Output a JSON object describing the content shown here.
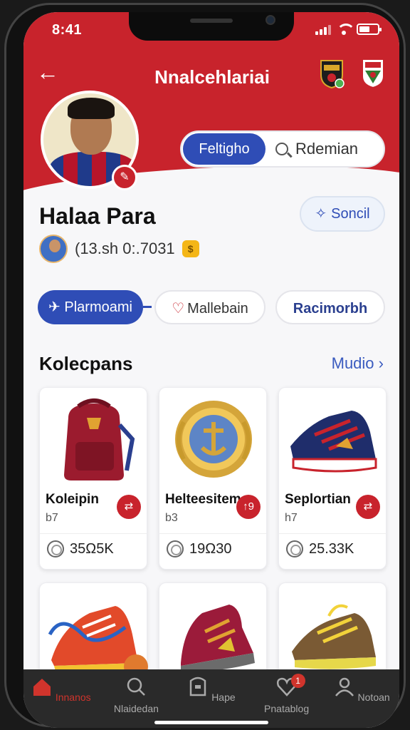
{
  "status": {
    "time": "8:41"
  },
  "header": {
    "title": "Nnalcehlariai"
  },
  "segment": {
    "active_label": "Feltigho",
    "search_label": "Rdemian"
  },
  "profile": {
    "name": "Halaa Para",
    "stats": "(13.sh 0:.7031",
    "social_label": "Soncil"
  },
  "chips": [
    {
      "label": "Plarmoami"
    },
    {
      "label": "Mallebain"
    },
    {
      "label": "Racimorbh"
    }
  ],
  "section": {
    "title": "Kolecpans",
    "more": "Mudio"
  },
  "cards": [
    {
      "name": "Koleipin",
      "sub": "b7",
      "price": "35Ω5K",
      "icon": "backpack-image"
    },
    {
      "name": "Helteesitem",
      "sub": "b3",
      "price": "19Ω30",
      "icon": "medal-image"
    },
    {
      "name": "Seplortian",
      "sub": "h7",
      "price": "25.33K",
      "icon": "sneaker-image"
    },
    {
      "name": "",
      "sub": "",
      "price": "",
      "icon": "sneaker-image"
    },
    {
      "name": "",
      "sub": "",
      "price": "",
      "icon": "boot-image"
    },
    {
      "name": "",
      "sub": "",
      "price": "",
      "icon": "trail-shoe-image"
    }
  ],
  "card_button_glyphs": [
    "⇄",
    "↑9",
    "⇄"
  ],
  "tabs": [
    {
      "label": "Innanos",
      "icon": "home-icon",
      "active": true
    },
    {
      "label": "Nlaidedan",
      "icon": "search-icon",
      "active": false
    },
    {
      "label": "Hape",
      "icon": "bag-icon",
      "active": false
    },
    {
      "label": "Pnatablog",
      "icon": "heart-icon",
      "active": false,
      "badge": "1"
    },
    {
      "label": "Notoan",
      "icon": "person-icon",
      "active": false
    }
  ],
  "colors": {
    "brand_red": "#c8232c",
    "accent_blue": "#2f4db6",
    "tabbar": "#2a2a2a"
  }
}
